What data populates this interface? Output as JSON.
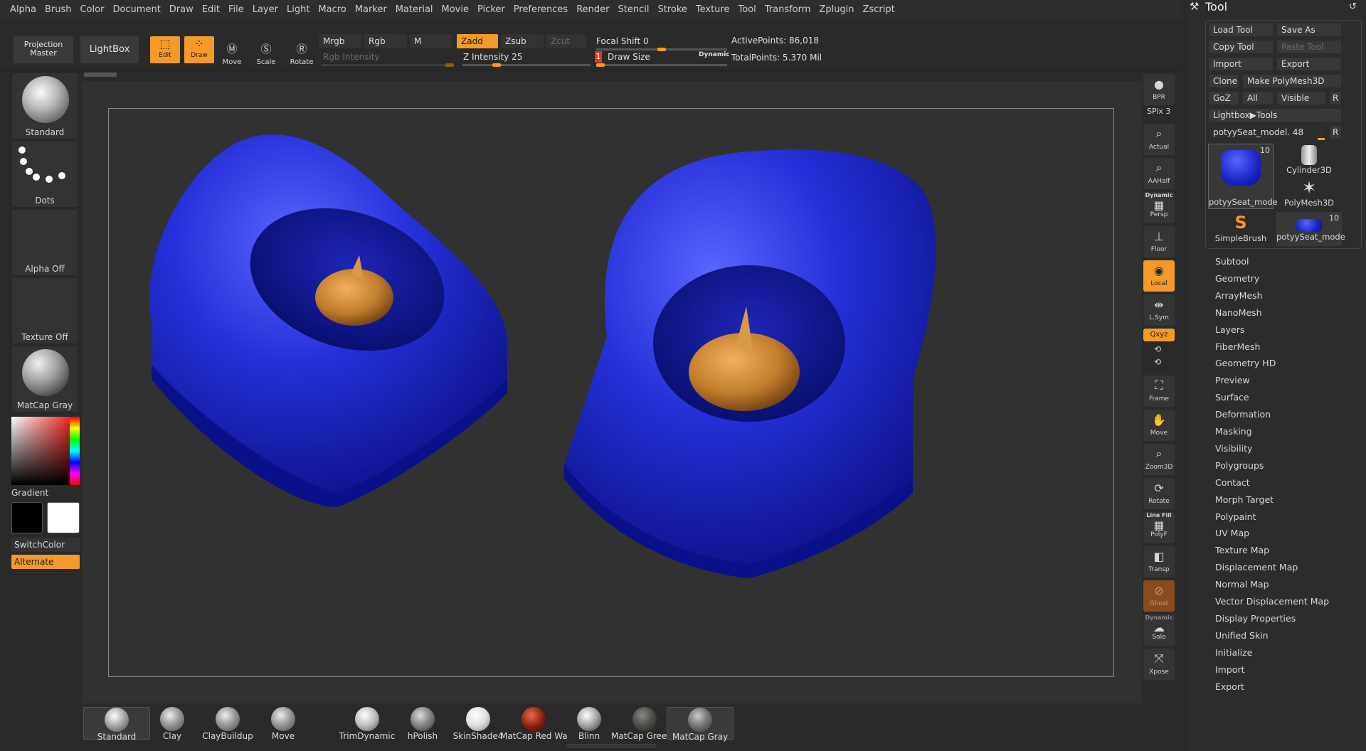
{
  "menu": [
    "Alpha",
    "Brush",
    "Color",
    "Document",
    "Draw",
    "Edit",
    "File",
    "Layer",
    "Light",
    "Macro",
    "Marker",
    "Material",
    "Movie",
    "Picker",
    "Preferences",
    "Render",
    "Stencil",
    "Stroke",
    "Texture",
    "Tool",
    "Transform",
    "Zplugin",
    "Zscript"
  ],
  "toolbar": {
    "projection_master": "Projection Master",
    "lightbox": "LightBox",
    "edit": "Edit",
    "draw": "Draw",
    "move": "Move",
    "scale": "Scale",
    "rotate": "Rotate",
    "mrgb": "Mrgb",
    "rgb": "Rgb",
    "m": "M",
    "zadd": "Zadd",
    "zsub": "Zsub",
    "zcut": "Zcut",
    "rgb_intensity": "Rgb Intensity",
    "z_intensity": "Z Intensity 25",
    "focal_shift": "Focal Shift 0",
    "draw_size_num": "1",
    "draw_size": "Draw Size",
    "dynamic": "Dynamic",
    "active_points": "ActivePoints: 86,018",
    "total_points": "TotalPoints: 5.370 Mil",
    "z_intensity_level": 0.25,
    "focal_shift_level": 0.5,
    "draw_size_level": 0.0
  },
  "left": {
    "brush": "Standard",
    "stroke": "Dots",
    "alpha": "Alpha Off",
    "texture": "Texture Off",
    "material": "MatCap Gray",
    "gradient": "Gradient",
    "switch_color": "SwitchColor",
    "alternate": "Alternate"
  },
  "rstrip": {
    "bpr": "BPR",
    "spix": "SPix 3",
    "actual": "Actual",
    "aahalf": "AAHalf",
    "dynamic": "Dynamic",
    "persp": "Persp",
    "floor": "Floor",
    "local": "Local",
    "lsym": "L.Sym",
    "xyz": "Qxyz",
    "frame": "Frame",
    "move": "Move",
    "zoom3d": "Zoom3D",
    "rotate": "Rotate",
    "line_fill": "Line Fill",
    "polyf": "PolyF",
    "transp": "Transp",
    "ghost": "Ghost",
    "dynamic2": "Dynamic",
    "solo": "Solo",
    "xpose": "Xpose"
  },
  "tool": {
    "title": "Tool",
    "load_tool": "Load Tool",
    "save_as": "Save As",
    "copy_tool": "Copy Tool",
    "paste_tool": "Paste Tool",
    "import": "Import",
    "export": "Export",
    "clone": "Clone",
    "make_polymesh": "Make PolyMesh3D",
    "goz": "GoZ",
    "all": "All",
    "visible": "Visible",
    "r": "R",
    "lightbox_tools": "Lightbox▶Tools",
    "current_tool": "potyySeat_model. 48",
    "tiles": [
      {
        "label": "potyySeat_mode",
        "count": "10"
      },
      {
        "label": "Cylinder3D",
        "count": ""
      },
      {
        "label": "PolyMesh3D",
        "count": ""
      },
      {
        "label": "SimpleBrush",
        "count": ""
      },
      {
        "label": "potyySeat_mode",
        "count": "10"
      }
    ],
    "subpalettes": [
      "Subtool",
      "Geometry",
      "ArrayMesh",
      "NanoMesh",
      "Layers",
      "FiberMesh",
      "Geometry HD",
      "Preview",
      "Surface",
      "Deformation",
      "Masking",
      "Visibility",
      "Polygroups",
      "Contact",
      "Morph Target",
      "Polypaint",
      "UV Map",
      "Texture Map",
      "Displacement Map",
      "Normal Map",
      "Vector Displacement Map",
      "Display Properties",
      "Unified Skin",
      "Initialize",
      "Import",
      "Export"
    ]
  },
  "bottom": [
    "Standard",
    "Clay",
    "ClayBuildup",
    "Move",
    "TrimDynamic",
    "hPolish",
    "SkinShade4",
    "MatCap Red Wax",
    "Blinn",
    "MatCap GreenCl",
    "MatCap Gray"
  ],
  "colors": {
    "accent": "#f39a2b",
    "seat": "#2a36d8",
    "poop": "#c98a3a"
  }
}
